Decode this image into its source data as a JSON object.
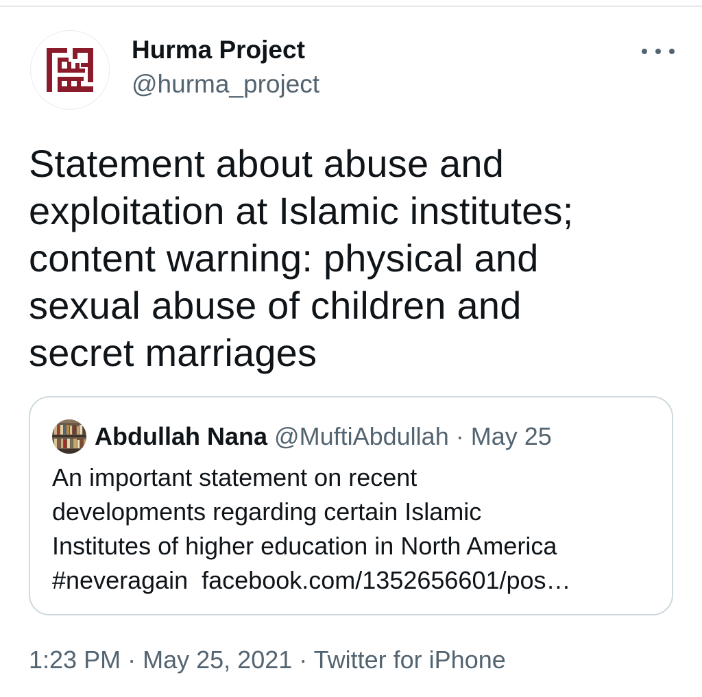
{
  "account": {
    "display_name": "Hurma Project",
    "handle": "@hurma_project",
    "avatar_icon": "hurma-logo-icon",
    "brand_color": "#8b1a2b"
  },
  "menu": {
    "more_icon": "more-options-icon"
  },
  "tweet": {
    "lines": [
      "Statement about abuse and",
      "exploitation at Islamic institutes;",
      "content warning: physical and",
      "sexual abuse of children and",
      "secret marriages"
    ]
  },
  "quote": {
    "author_name": "Abdullah Nana",
    "author_handle": "@MuftiAbdullah",
    "separator": "·",
    "date": "May 25",
    "lines": [
      "An important statement on recent",
      "developments regarding certain Islamic",
      "Institutes of higher education in North America",
      "#neveragain  facebook.com/1352656601/pos…"
    ]
  },
  "meta": {
    "time": "1:23 PM",
    "sep1": "·",
    "date": "May 25, 2021",
    "sep2": "·",
    "source": "Twitter for iPhone"
  },
  "colors": {
    "text_primary": "#0f1419",
    "text_secondary": "#536471",
    "border": "#cfd9de"
  }
}
